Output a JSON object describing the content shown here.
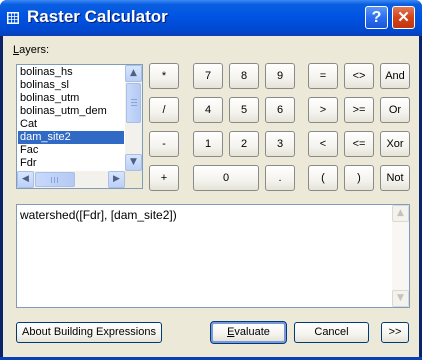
{
  "window": {
    "title": "Raster Calculator",
    "help_label": "?",
    "close_label": "✕"
  },
  "layers": {
    "label_underlined": "L",
    "label_rest": "ayers:",
    "items": [
      {
        "label": "bolinas_hs",
        "selected": false
      },
      {
        "label": "bolinas_sl",
        "selected": false
      },
      {
        "label": "bolinas_utm",
        "selected": false
      },
      {
        "label": "bolinas_utm_dem",
        "selected": false
      },
      {
        "label": "Cat",
        "selected": false
      },
      {
        "label": "dam_site2",
        "selected": true
      },
      {
        "label": "Fac",
        "selected": false
      },
      {
        "label": "Fdr",
        "selected": false
      }
    ]
  },
  "calculator": {
    "row1": [
      "*",
      "7",
      "8",
      "9",
      "=",
      "<>",
      "And"
    ],
    "row2": [
      "/",
      "4",
      "5",
      "6",
      ">",
      ">=",
      "Or"
    ],
    "row3": [
      "-",
      "1",
      "2",
      "3",
      "<",
      "<=",
      "Xor"
    ],
    "row4": [
      "+",
      "0",
      ".",
      "(",
      ")",
      "Not"
    ]
  },
  "expression": {
    "value": "watershed([Fdr], [dam_site2])"
  },
  "actions": {
    "about_label": "About Building Expressions",
    "evaluate_underlined": "E",
    "evaluate_rest": "valuate",
    "cancel_label": "Cancel",
    "expand_label": ">>"
  },
  "colors": {
    "selection": "#316ac5",
    "titlebar": "#0054e3",
    "dialog_bg": "#ece9d8"
  }
}
